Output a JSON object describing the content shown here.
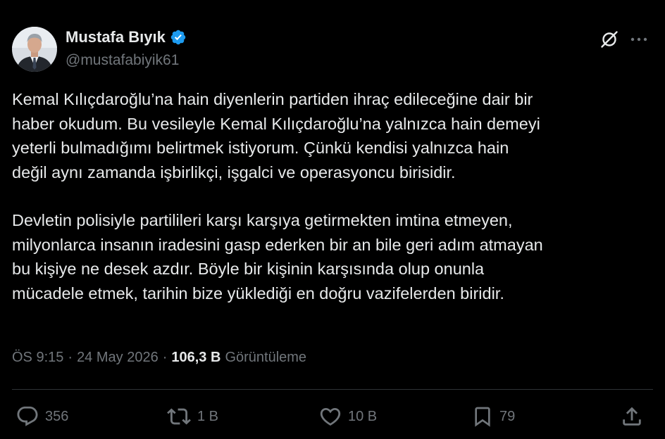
{
  "author": {
    "display_name": "Mustafa Bıyık",
    "handle": "@mustafabiyik61",
    "verified": true
  },
  "tweet": {
    "paragraphs": [
      [
        "Kemal Kılıçdaroğlu’na hain diyenlerin partiden ihraç edileceğine dair bir",
        "haber okudum. Bu vesileyle Kemal Kılıçdaroğlu’na yalnızca hain demeyi",
        "yeterli bulmadığımı belirtmek istiyorum. Çünkü kendisi yalnızca hain",
        "değil aynı zamanda işbirlikçi, işgalci ve operasyoncu birisidir."
      ],
      [
        "Devletin polisiyle partilileri karşı karşıya getirmekten imtina etmeyen,",
        "milyonlarca insanın iradesini gasp ederken bir an bile geri adım atmayan",
        "bu kişiye ne desek azdır. Böyle bir kişinin karşısında olup onunla",
        "mücadele etmek, tarihin bize yüklediği en doğru vazifelerden biridir."
      ]
    ]
  },
  "meta": {
    "time": "ÖS 9:15",
    "separator": "·",
    "date": "24 May 2026",
    "views_count": "106,3 B",
    "views_label": "Görüntüleme"
  },
  "actions": {
    "replies": "356",
    "reposts": "1 B",
    "likes": "10 B",
    "bookmarks": "79"
  },
  "icons": {
    "verified": "verified-badge-icon",
    "grok": "grok-icon",
    "more": "more-icon",
    "reply": "reply-icon",
    "repost": "repost-icon",
    "like": "heart-icon",
    "bookmark": "bookmark-icon",
    "share": "share-icon"
  },
  "colors": {
    "background": "#000000",
    "text_primary": "#e7e9ea",
    "text_secondary": "#71767b",
    "divider": "#2f3336",
    "verified_blue": "#1d9bf0"
  }
}
